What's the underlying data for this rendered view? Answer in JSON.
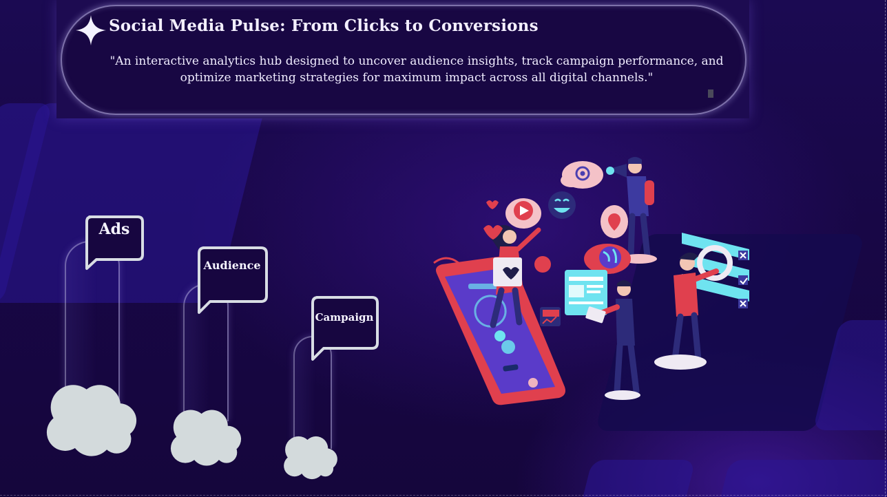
{
  "header": {
    "title": "Social Media Pulse: From Clicks to Conversions",
    "subtitle": "\"An interactive analytics hub designed to uncover audience insights, track campaign performance, and optimize marketing strategies for maximum impact across all digital channels.\""
  },
  "nav": {
    "items": [
      {
        "id": "ads",
        "label": "Ads"
      },
      {
        "id": "audience",
        "label": "Audience"
      },
      {
        "id": "campaign",
        "label": "Campaign"
      }
    ]
  },
  "illustration": {
    "icons": [
      "at-sign-icon",
      "megaphone-icon",
      "play-icon",
      "smiley-icon",
      "heart-icon",
      "location-pin-icon",
      "globe-icon",
      "wifi-icon",
      "chart-icon",
      "checklist-icon"
    ]
  },
  "colors": {
    "background": "#170640",
    "accent_red": "#e0404e",
    "accent_cyan": "#6fe3f0",
    "bubble_border": "#d8dde4",
    "cloud": "#d3dadc"
  }
}
